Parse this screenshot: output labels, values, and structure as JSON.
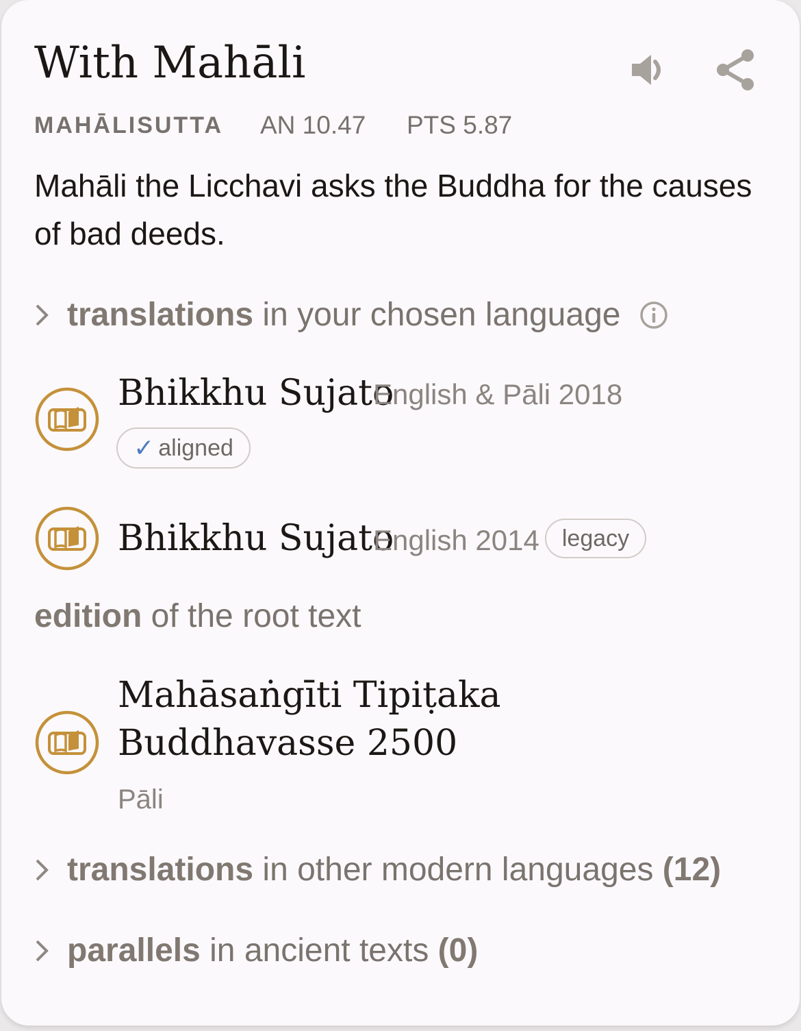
{
  "header": {
    "title": "With Mahāli",
    "sutta_name": "MAHĀLISUTTA",
    "reference": "AN 10.47",
    "pts": "PTS 5.87"
  },
  "blurb": "Mahāli the Licchavi asks the Buddha for the causes of bad deeds.",
  "translations_chosen": {
    "bold": "translations",
    "rest": " in your chosen language"
  },
  "translations": [
    {
      "translator": "Bhikkhu Sujato",
      "lang": "English & Pāli 2018",
      "badge_check": "✓",
      "badge": "aligned"
    },
    {
      "translator": "Bhikkhu Sujato",
      "lang": "English 2014",
      "badge": "legacy"
    }
  ],
  "edition_heading": {
    "bold": "edition",
    "rest": " of the root text"
  },
  "edition": {
    "name": "Mahāsaṅgīti Tipiṭaka Buddhavasse 2500",
    "lang": "Pāli"
  },
  "other_translations": {
    "bold": "translations",
    "rest": " in other modern languages ",
    "count": "(12)"
  },
  "parallels": {
    "bold": "parallels",
    "rest": " in ancient texts ",
    "count": "(0)"
  },
  "colors": {
    "accent_gold": "#c4913a",
    "muted_text": "#7a736e",
    "check_blue": "#4f7bc0"
  },
  "icons": [
    "speaker-icon",
    "share-icon",
    "chevron-right-icon",
    "info-icon",
    "book-icon"
  ]
}
